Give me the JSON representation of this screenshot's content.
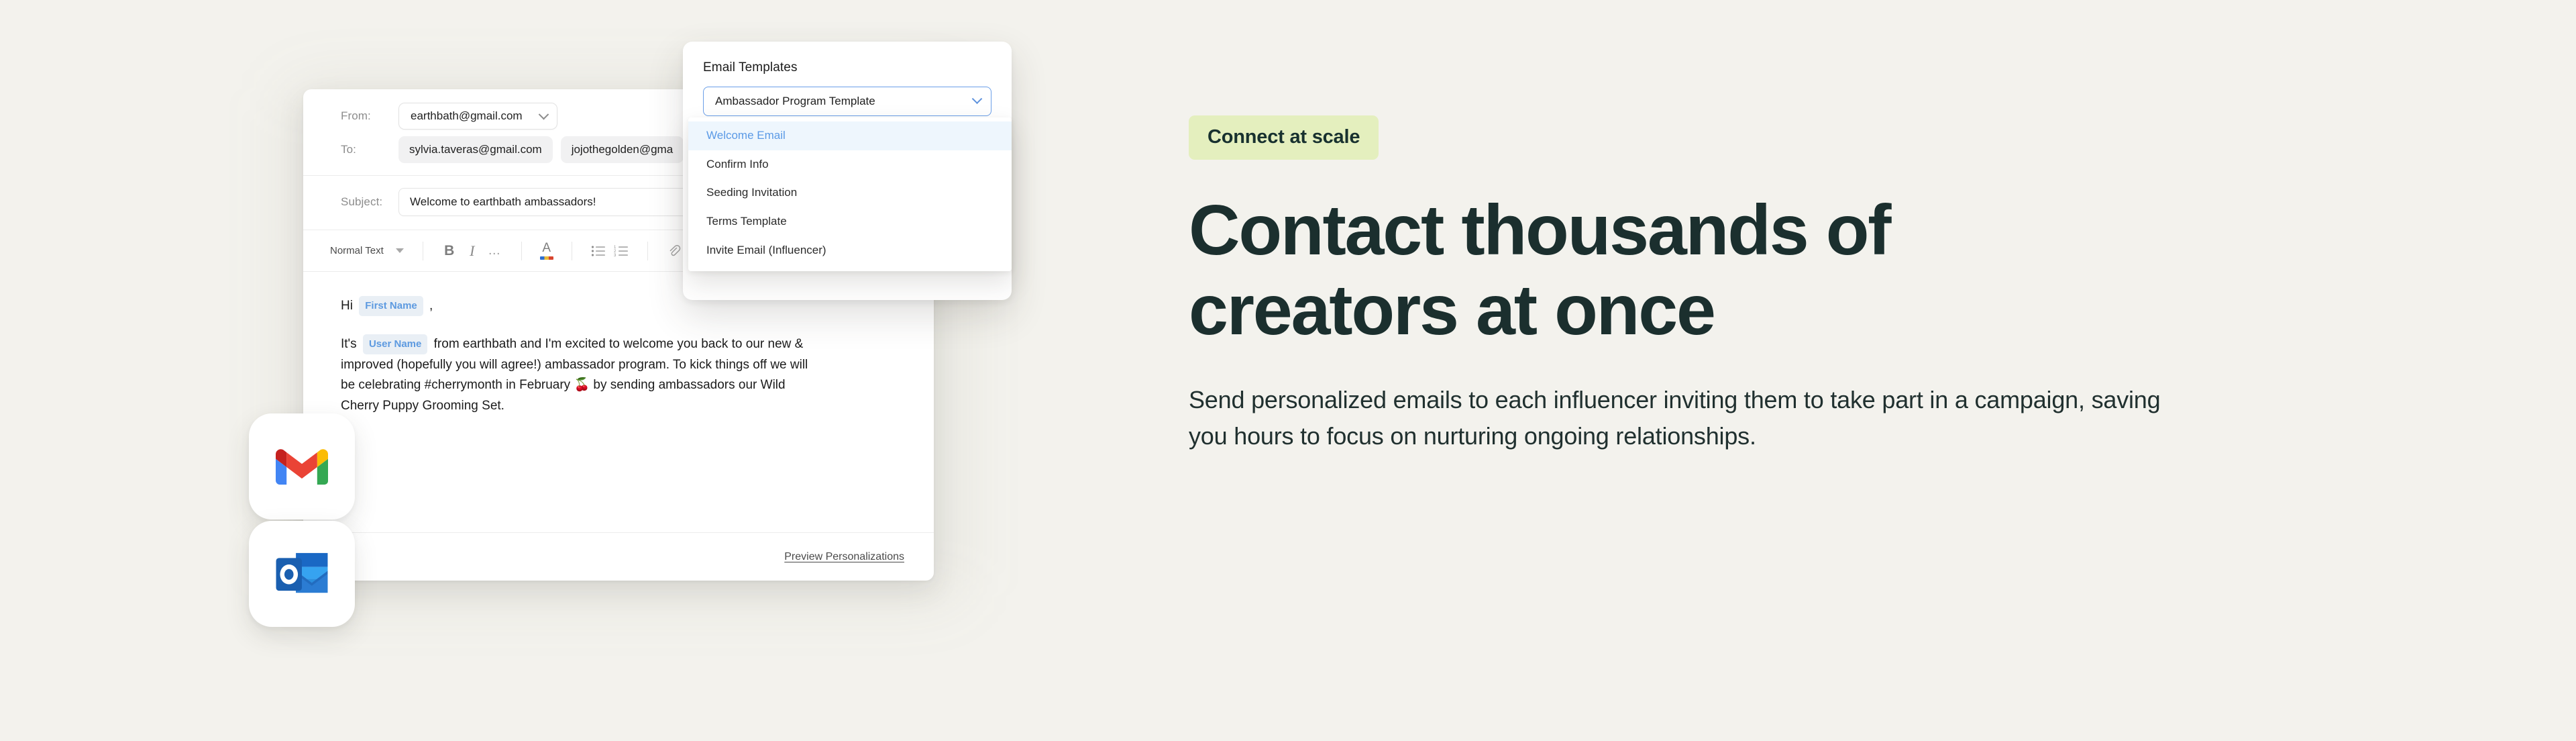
{
  "page": {
    "background_color": "#f3f2ed"
  },
  "email_composer": {
    "from": {
      "label": "From:",
      "value": "earthbath@gmail.com"
    },
    "to": {
      "label": "To:",
      "recipients": [
        "sylvia.taveras@gmail.com",
        "jojothegolden@gma"
      ]
    },
    "subject": {
      "label": "Subject:",
      "value": "Welcome to earthbath ambassadors!"
    },
    "toolbar": {
      "style_label": "Normal Text",
      "buttons": [
        "bold-button",
        "italic-button",
        "more-formatting-button",
        "text-color-button",
        "bulleted-list-button",
        "numbered-list-button",
        "attachment-button"
      ],
      "bold_glyph": "B",
      "italic_glyph": "I",
      "more_glyph": "…",
      "text_color_glyph": "A",
      "bulleted_list_glyph": "☰",
      "numbered_list_glyph": "☰",
      "attachment_glyph": "ℒ"
    },
    "body": {
      "greeting_prefix": "Hi",
      "greeting_tag": "First Name",
      "greeting_suffix": ",",
      "paragraph_prefix": "It's",
      "paragraph_tag": "User Name",
      "paragraph_text": "from earthbath and I'm excited to welcome you back to our new & improved (hopefully you will agree!) ambassador program. To kick things off we will be celebrating #cherrymonth in February 🍒 by sending ambassadors our Wild Cherry Puppy Grooming Set."
    },
    "footer": {
      "preview_link": "Preview Personalizations"
    }
  },
  "templates_panel": {
    "title": "Email Templates",
    "selected_template": "Ambassador Program Template",
    "options": [
      "Welcome Email",
      "Confirm Info",
      "Seeding Invitation",
      "Terms Template",
      "Invite Email (Influencer)"
    ],
    "active_option_index": 0,
    "accent_color": "#5b9ae6"
  },
  "app_tiles": [
    {
      "name": "gmail-icon",
      "label": "Gmail"
    },
    {
      "name": "outlook-icon",
      "label": "Outlook"
    }
  ],
  "marketing": {
    "badge": "Connect at scale",
    "badge_color": "#e4efbe",
    "headline": "Contact thousands of creators at once",
    "headline_color": "#1b2f2e",
    "subcopy": "Send personalized emails to each influencer inviting them to take part in a campaign, saving you hours to focus on nurturing ongoing relationships."
  }
}
